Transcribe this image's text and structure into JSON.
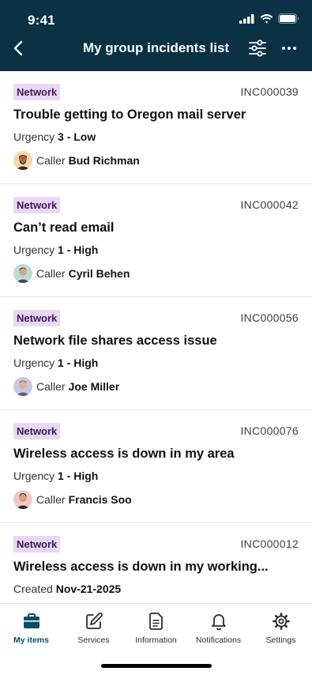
{
  "status_bar": {
    "time": "9:41",
    "icons": [
      "signal-icon",
      "wifi-icon",
      "battery-icon"
    ]
  },
  "header": {
    "title": "My group incidents list",
    "back_icon": "chevron-left-icon",
    "filter_icon": "sliders-icon",
    "more_icon": "more-horizontal-icon"
  },
  "incidents": [
    {
      "category": "Network",
      "number": "INC000039",
      "title": "Trouble getting to Oregon mail server",
      "meta_label": "Urgency",
      "meta_value": "3 - Low",
      "caller_label": "Caller",
      "caller": "Bud Richman"
    },
    {
      "category": "Network",
      "number": "INC000042",
      "title": "Can’t read email",
      "meta_label": "Urgency",
      "meta_value": "1 - High",
      "caller_label": "Caller",
      "caller": "Cyril Behen"
    },
    {
      "category": "Network",
      "number": "INC000056",
      "title": "Network file shares access issue",
      "meta_label": "Urgency",
      "meta_value": "1 - High",
      "caller_label": "Caller",
      "caller": "Joe Miller"
    },
    {
      "category": "Network",
      "number": "INC000076",
      "title": "Wireless access is down in my area",
      "meta_label": "Urgency",
      "meta_value": "1 - High",
      "caller_label": "Caller",
      "caller": "Francis Soo"
    },
    {
      "category": "Network",
      "number": "INC000012",
      "title": "Wireless access is down in my working...",
      "meta_label": "Created",
      "meta_value": "Nov-21-2025"
    }
  ],
  "tabs": [
    {
      "label": "My items",
      "icon": "briefcase-icon",
      "active": true
    },
    {
      "label": "Services",
      "icon": "edit-icon",
      "active": false
    },
    {
      "label": "Information",
      "icon": "document-icon",
      "active": false
    },
    {
      "label": "Notifications",
      "icon": "bell-icon",
      "active": false
    },
    {
      "label": "Settings",
      "icon": "gear-icon",
      "active": false
    }
  ],
  "colors": {
    "header_bg": "#0a3144",
    "badge_bg": "#ead6f7",
    "active_tab": "#0a4e66"
  }
}
